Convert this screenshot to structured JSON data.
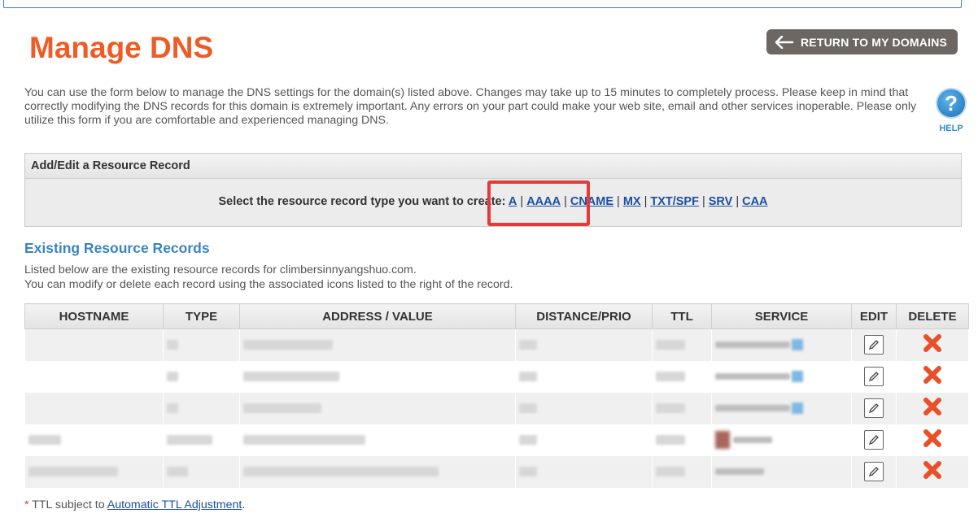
{
  "page": {
    "title": "Manage DNS",
    "return_button": "RETURN TO MY DOMAINS",
    "intro": "You can use the form below to manage the DNS settings for the domain(s) listed above. Changes may take up to 15 minutes to completely process. Please keep in mind that correctly modifying the DNS records for this domain is extremely important. Any errors on your part could make your web site, email and other services inoperable. Please only utilize this form if you are comfortable and experienced managing DNS.",
    "help_label": "HELP",
    "help_glyph": "?"
  },
  "add_record": {
    "header": "Add/Edit a Resource Record",
    "prompt": "Select the resource record type you want to create:",
    "types": [
      "A",
      "AAAA",
      "CNAME",
      "MX",
      "TXT/SPF",
      "SRV",
      "CAA"
    ]
  },
  "existing": {
    "title": "Existing Resource Records",
    "line1": "Listed below are the existing resource records for climbersinnyangshuo.com.",
    "line2": "You can modify or delete each record using the associated icons listed to the right of the record.",
    "columns": {
      "hostname": "HOSTNAME",
      "type": "TYPE",
      "address": "ADDRESS / VALUE",
      "distance": "DISTANCE/PRIO",
      "ttl": "TTL",
      "service": "SERVICE",
      "edit": "EDIT",
      "delete": "DELETE"
    },
    "row_count": 5
  },
  "footnote": {
    "star": "*",
    "text": " TTL subject to ",
    "link": "Automatic TTL Adjustment",
    "end": "."
  },
  "colors": {
    "title": "#ef5b25",
    "section_title": "#3a84c4",
    "link": "#1c4fa0",
    "highlight": "#e53a3a",
    "delete": "#e8502a"
  },
  "icons": {
    "return": "arrow-left-icon",
    "help": "question-circle-icon",
    "edit": "edit-pencil-icon",
    "delete": "delete-x-icon"
  }
}
